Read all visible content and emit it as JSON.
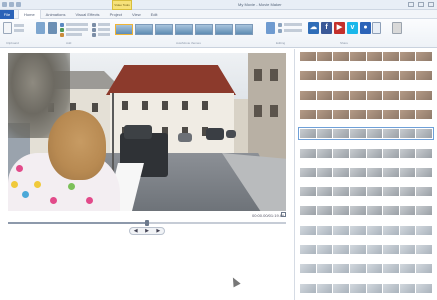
{
  "window": {
    "title": "My Movie - Movie Maker",
    "contextual_tab": "Video Tools"
  },
  "tabs": {
    "file": "File",
    "items": [
      "Home",
      "Animations",
      "Visual Effects",
      "Project",
      "View",
      "Edit"
    ],
    "active_index": 0
  },
  "ribbon": {
    "groups": [
      "Clipboard",
      "Add",
      "AutoMovie themes",
      "Editing",
      "Share"
    ],
    "themes_count": 7,
    "selected_theme_index": 0,
    "share_icons": [
      "cloud-icon",
      "facebook-icon",
      "youtube-icon",
      "vimeo-icon",
      "flickr-icon"
    ],
    "save_movie_label": "Save movie",
    "sign_in_label": "Sign in"
  },
  "player": {
    "timecode": "00:00.00/01:19.66",
    "progress_fraction": 0.5,
    "controls": [
      "previous-frame",
      "play",
      "next-frame"
    ]
  },
  "storyboard": {
    "clip_count": 13,
    "selected_clip_index": 4
  },
  "colors": {
    "accent": "#2b63b8",
    "ribbon_bg": "#eef2f7",
    "selection": "#6fa0d8"
  }
}
